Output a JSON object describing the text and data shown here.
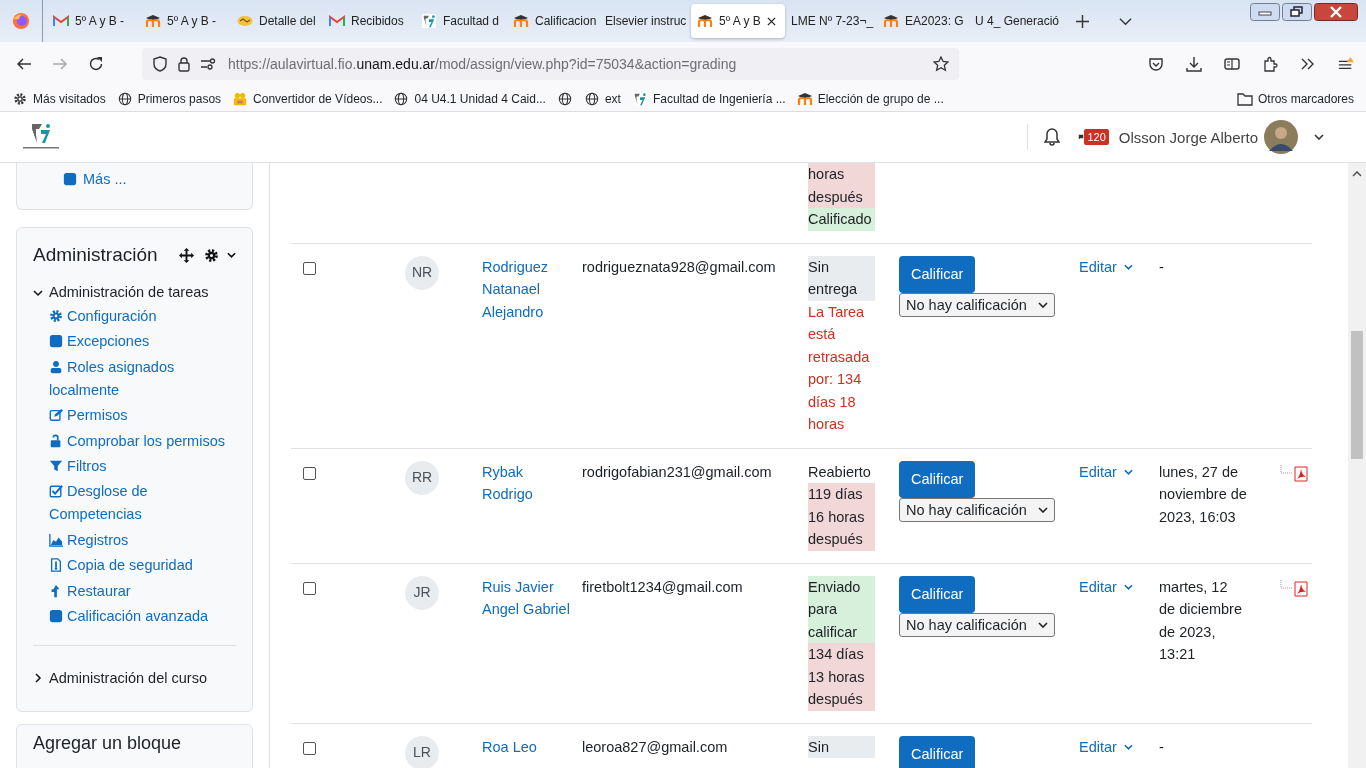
{
  "browser": {
    "tabs": [
      {
        "title": "5º A y B -",
        "kind": "gmail",
        "selected": false
      },
      {
        "title": "5º A y B -",
        "kind": "moodle",
        "selected": false
      },
      {
        "title": "Detalle del",
        "kind": "coin",
        "selected": false
      },
      {
        "title": "Recibidos",
        "kind": "gmail",
        "selected": false
      },
      {
        "title": "Facultad d",
        "kind": "fi",
        "selected": false
      },
      {
        "title": "Calificacion",
        "kind": "moodle",
        "selected": false
      },
      {
        "title": "Elsevier instruc",
        "kind": "plain",
        "selected": false
      },
      {
        "title": "5º A y B",
        "kind": "moodle",
        "selected": true
      },
      {
        "title": "LME Nº 7-23¬_",
        "kind": "plain",
        "selected": false
      },
      {
        "title": "EA2023: G",
        "kind": "moodle",
        "selected": false
      },
      {
        "title": "U 4_ Generació",
        "kind": "plain",
        "selected": false
      }
    ],
    "url": {
      "prefix": "https://aulavirtual.fio.",
      "domain": "unam.edu.ar",
      "path": "/mod/assign/view.php?id=75034&action=grading"
    },
    "bookmarks": [
      {
        "label": "Más visitados",
        "kind": "gear"
      },
      {
        "label": "Primeros pasos",
        "kind": "globe"
      },
      {
        "label": "Convertidor de Vídeos...",
        "kind": "camera"
      },
      {
        "label": "04 U4.1 Unidad 4 Caid...",
        "kind": "globe"
      },
      {
        "kind": "globe"
      },
      {
        "label": "ext",
        "kind": "globe"
      },
      {
        "label": "Facultad de Ingeniería ...",
        "kind": "fi"
      },
      {
        "label": "Elección de grupo de ...",
        "kind": "moodle"
      }
    ],
    "other_bookmarks": "Otros marcadores"
  },
  "header": {
    "message_count": "120",
    "user_name": "Olsson Jorge Alberto"
  },
  "sidebar": {
    "more_link": "Más ...",
    "admin": {
      "title": "Administración",
      "sections": [
        {
          "label": "Administración de tareas",
          "expanded": true,
          "children": [
            {
              "label": "Configuración",
              "kind": "gear"
            },
            {
              "label": "Excepciones",
              "kind": "square"
            },
            {
              "label": "Roles asignados localmente",
              "kind": "user"
            },
            {
              "label": "Permisos",
              "kind": "edit"
            },
            {
              "label": "Comprobar los permisos",
              "kind": "unlock"
            },
            {
              "label": "Filtros",
              "kind": "filter"
            },
            {
              "label": "Desglose de Competencias",
              "kind": "check"
            },
            {
              "label": "Registros",
              "kind": "chart"
            },
            {
              "label": "Copia de seguridad",
              "kind": "file"
            },
            {
              "label": "Restaurar",
              "kind": "upload"
            },
            {
              "label": "Calificación avanzada",
              "kind": "square"
            }
          ]
        },
        {
          "label": "Administración del curso",
          "expanded": false
        }
      ]
    },
    "add_block": "Agregar un bloque"
  },
  "table": {
    "rows": [
      {
        "kind": "continued",
        "status": [
          {
            "text": "horas después",
            "kind": "late-bg"
          },
          {
            "text": "Calificado",
            "kind": "ok"
          }
        ]
      },
      {
        "kind": "student",
        "checked": false,
        "initials": "NR",
        "name": "Rodriguez Natanael Alejandro",
        "email": "rodrigueznata928@gmail.com",
        "status": [
          {
            "text": "Sin entrega",
            "kind": "neutral"
          },
          {
            "text": "La Tarea está retrasada por: 134 días 18 horas",
            "kind": "late-text"
          }
        ],
        "grade_button": "Calificar",
        "grade": "No hay calificación",
        "edit": "Editar",
        "date": "-",
        "file": false
      },
      {
        "kind": "student",
        "checked": false,
        "initials": "RR",
        "name": "Rybak Rodrigo",
        "email": "rodrigofabian231@gmail.com",
        "status": [
          {
            "text": "Reabierto",
            "kind": "plain"
          },
          {
            "text": "119 días 16 horas después",
            "kind": "late-bg"
          }
        ],
        "grade_button": "Calificar",
        "grade": "No hay calificación",
        "edit": "Editar",
        "date": "lunes, 27 de noviembre de 2023, 16:03",
        "file": true
      },
      {
        "kind": "student",
        "checked": false,
        "initials": "JR",
        "name": "Ruis Javier Angel Gabriel",
        "email": "firetbolt1234@gmail.com",
        "status": [
          {
            "text": "Enviado para calificar",
            "kind": "ok"
          },
          {
            "text": "134 días 13 horas después",
            "kind": "late-bg"
          }
        ],
        "grade_button": "Calificar",
        "grade": "No hay calificación",
        "edit": "Editar",
        "date": "martes, 12 de diciembre de 2023, 13:21",
        "file": true
      },
      {
        "kind": "student",
        "checked": false,
        "initials": "LR",
        "name": "Roa Leo",
        "email": "leoroa827@gmail.com",
        "status": [
          {
            "text": "Sin",
            "kind": "neutral"
          }
        ],
        "grade_button": "Calificar",
        "edit": "Editar",
        "date": "-",
        "file": false
      }
    ]
  }
}
